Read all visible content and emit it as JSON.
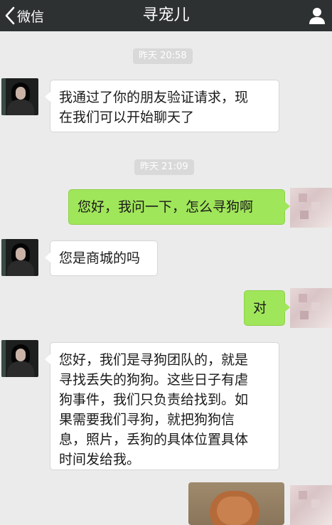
{
  "header": {
    "back_label": "微信",
    "title": "寻宠儿"
  },
  "messages": [
    {
      "type": "time",
      "text": "昨天 20:58"
    },
    {
      "type": "bubble",
      "side": "left",
      "lines": [
        "我通过了你的朋友验证请求，现",
        "在我们可以开始聊天了"
      ]
    },
    {
      "type": "time",
      "text": "昨天 21:09"
    },
    {
      "type": "bubble",
      "side": "right",
      "lines": [
        "您好，我问一下，怎么寻狗啊"
      ]
    },
    {
      "type": "bubble",
      "side": "left",
      "lines": [
        "您是商城的吗"
      ]
    },
    {
      "type": "bubble",
      "side": "right",
      "lines": [
        "对"
      ]
    },
    {
      "type": "bubble",
      "side": "left",
      "lines": [
        "您好，我们是寻狗团队的，就是",
        "寻找丢失的狗狗。这些日子有虐",
        "狗事件，我们只负责给找到。如",
        "果需要我们寻狗，就把狗狗信",
        "息，照片，丢狗的具体位置具体",
        "时间发给我。"
      ]
    },
    {
      "type": "image",
      "side": "right"
    }
  ],
  "colors": {
    "titlebar": "#2e3132",
    "chat_bg": "#ebebeb",
    "bubble_right": "#a0e65a",
    "bubble_left": "#ffffff",
    "time_badge": "#d9d9d9"
  },
  "icons": {
    "back": "chevron-left-icon",
    "profile": "person-icon"
  }
}
